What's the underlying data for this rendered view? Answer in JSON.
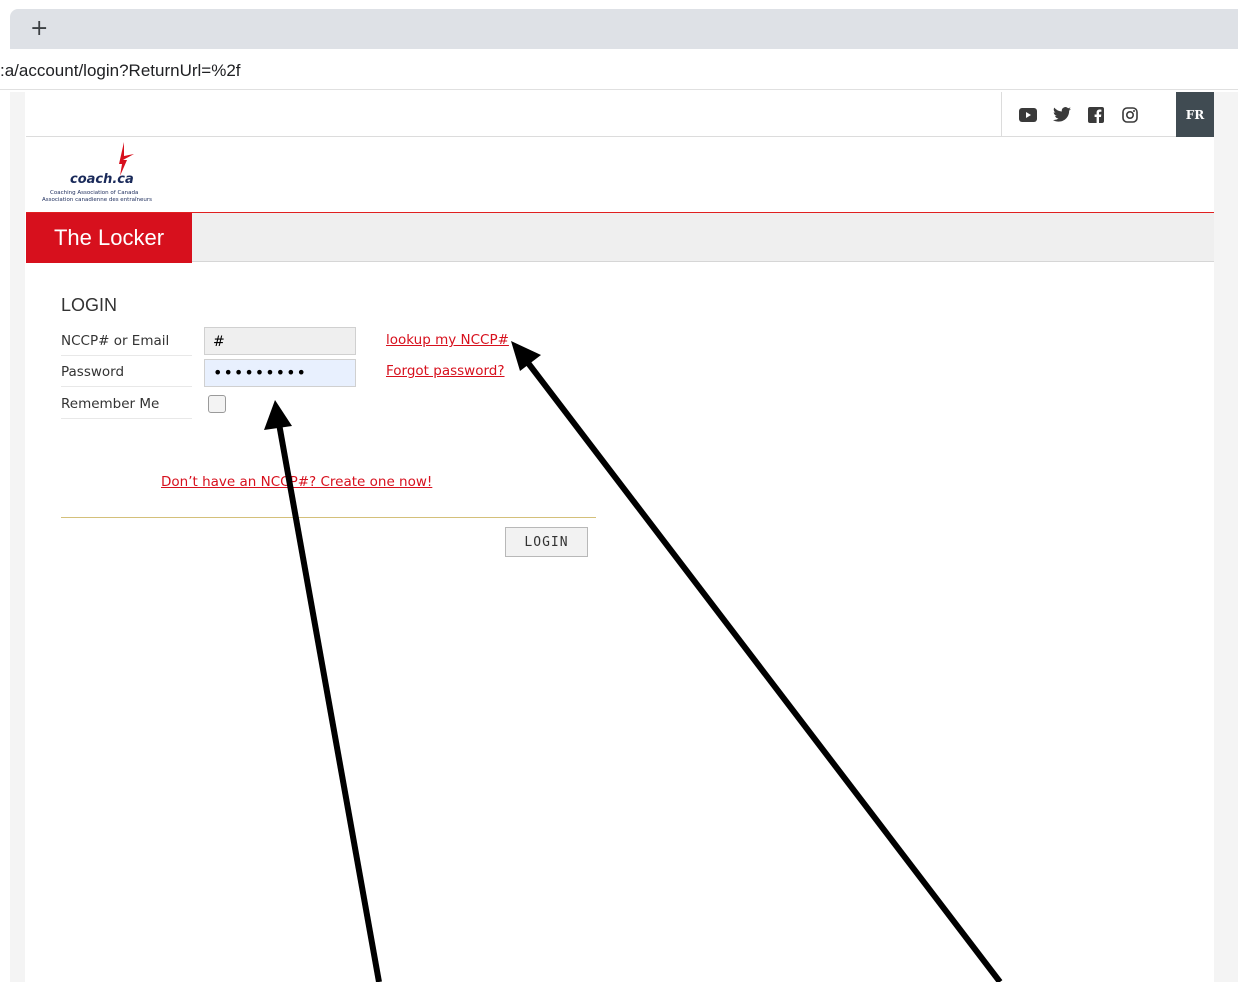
{
  "browser": {
    "new_tab_label": "+",
    "url": ":a/account/login?ReturnUrl=%2f"
  },
  "header": {
    "social_icons": [
      "youtube-icon",
      "twitter-icon",
      "facebook-icon",
      "instagram-icon"
    ],
    "language_toggle": "FR"
  },
  "logo": {
    "wordmark": "coach.ca",
    "tagline_en": "Coaching Association of Canada",
    "tagline_fr": "Association canadienne des entraîneurs"
  },
  "nav": {
    "brand_tab": "The Locker"
  },
  "login": {
    "title": "LOGIN",
    "fields": {
      "username_label": "NCCP# or Email",
      "username_value": "#",
      "password_label": "Password",
      "password_value": "•••••••••",
      "remember_label": "Remember Me"
    },
    "links": {
      "lookup": "lookup my NCCP#",
      "forgot": "Forgot password?",
      "create": "Don’t have an NCCP#? Create one now!"
    },
    "submit_label": "LOGIN"
  },
  "colors": {
    "brand_red": "#d7101d",
    "fr_button": "#404b52",
    "divider_gold": "#d4c07a"
  }
}
